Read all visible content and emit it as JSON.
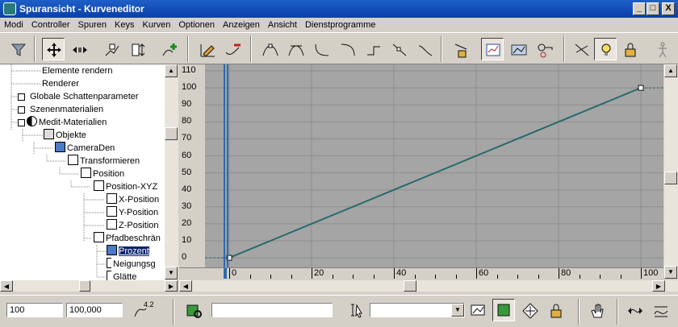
{
  "window": {
    "title": "Spuransicht - Kurveneditor",
    "minimize": "_",
    "maximize": "□",
    "close": "X"
  },
  "menu": [
    "Modi",
    "Controller",
    "Spuren",
    "Keys",
    "Kurven",
    "Optionen",
    "Anzeigen",
    "Ansicht",
    "Dienstprogramme"
  ],
  "tree": [
    {
      "label": "Elemente rendern",
      "level": 0
    },
    {
      "label": "Renderer",
      "level": 0
    },
    {
      "label": "Globale Schattenparameter",
      "level": 0
    },
    {
      "label": "Szenenmaterialien",
      "level": 0
    },
    {
      "label": "Medit-Materialien",
      "level": 0
    },
    {
      "label": "Objekte",
      "level": 1
    },
    {
      "label": "CameraDen",
      "level": 2
    },
    {
      "label": "Transformieren",
      "level": 3
    },
    {
      "label": "Position",
      "level": 4
    },
    {
      "label": "Position-XYZ",
      "level": 5
    },
    {
      "label": "X-Position",
      "level": 6
    },
    {
      "label": "Y-Position",
      "level": 6
    },
    {
      "label": "Z-Position",
      "level": 6
    },
    {
      "label": "Pfadbeschrän",
      "level": 5
    },
    {
      "label": "Prozent",
      "level": 6
    },
    {
      "label": "Neigungsg",
      "level": 6
    },
    {
      "label": "Glätte",
      "level": 6
    }
  ],
  "graph": {
    "y_ticks": [
      "110",
      "100",
      "90",
      "80",
      "70",
      "60",
      "50",
      "40",
      "30",
      "20",
      "10",
      "0"
    ],
    "x_ticks": [
      "0",
      "20",
      "40",
      "60",
      "80",
      "100"
    ],
    "current_frame": 0,
    "curve": {
      "start": [
        0,
        0
      ],
      "end": [
        100,
        100
      ]
    },
    "colors": {
      "curve": "#2a6a6a",
      "grid": "#8e8e8e",
      "timeline": "#2a6ab0"
    }
  },
  "status": {
    "frame_value": "100",
    "value_field": "100,000",
    "zoom_value": "4.2",
    "search_field": "",
    "dropdown_value": ""
  }
}
